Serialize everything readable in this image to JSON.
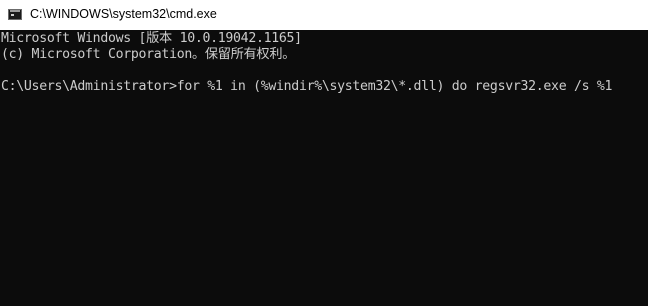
{
  "window": {
    "title": "C:\\WINDOWS\\system32\\cmd.exe",
    "icon": "cmd-console-icon"
  },
  "console": {
    "lines": [
      "Microsoft Windows [版本 10.0.19042.1165]",
      "(c) Microsoft Corporation。保留所有权利。",
      "",
      "C:\\Users\\Administrator>for %1 in (%windir%\\system32\\*.dll) do regsvr32.exe /s %1"
    ],
    "text_color": "#cccccc",
    "background_color": "#0c0c0c"
  }
}
